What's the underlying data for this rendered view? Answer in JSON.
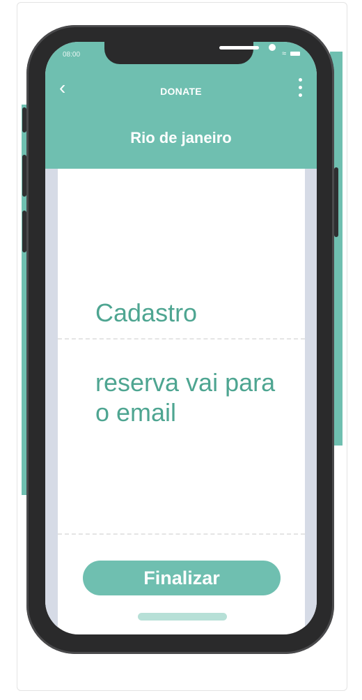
{
  "status_bar": {
    "time": "08:00"
  },
  "nav": {
    "back_icon": "chevron-left-icon",
    "title": "DONATE",
    "more_icon": "more-vertical-icon"
  },
  "header": {
    "subtitle": "Rio de janeiro"
  },
  "content": {
    "line1": "Cadastro",
    "line2": "reserva vai para",
    "line3": "o email"
  },
  "actions": {
    "finalizar_label": "Finalizar"
  },
  "colors": {
    "accent": "#6fbfb0",
    "text_accent": "#4ea591",
    "phone_frame": "#2a2a2b"
  }
}
